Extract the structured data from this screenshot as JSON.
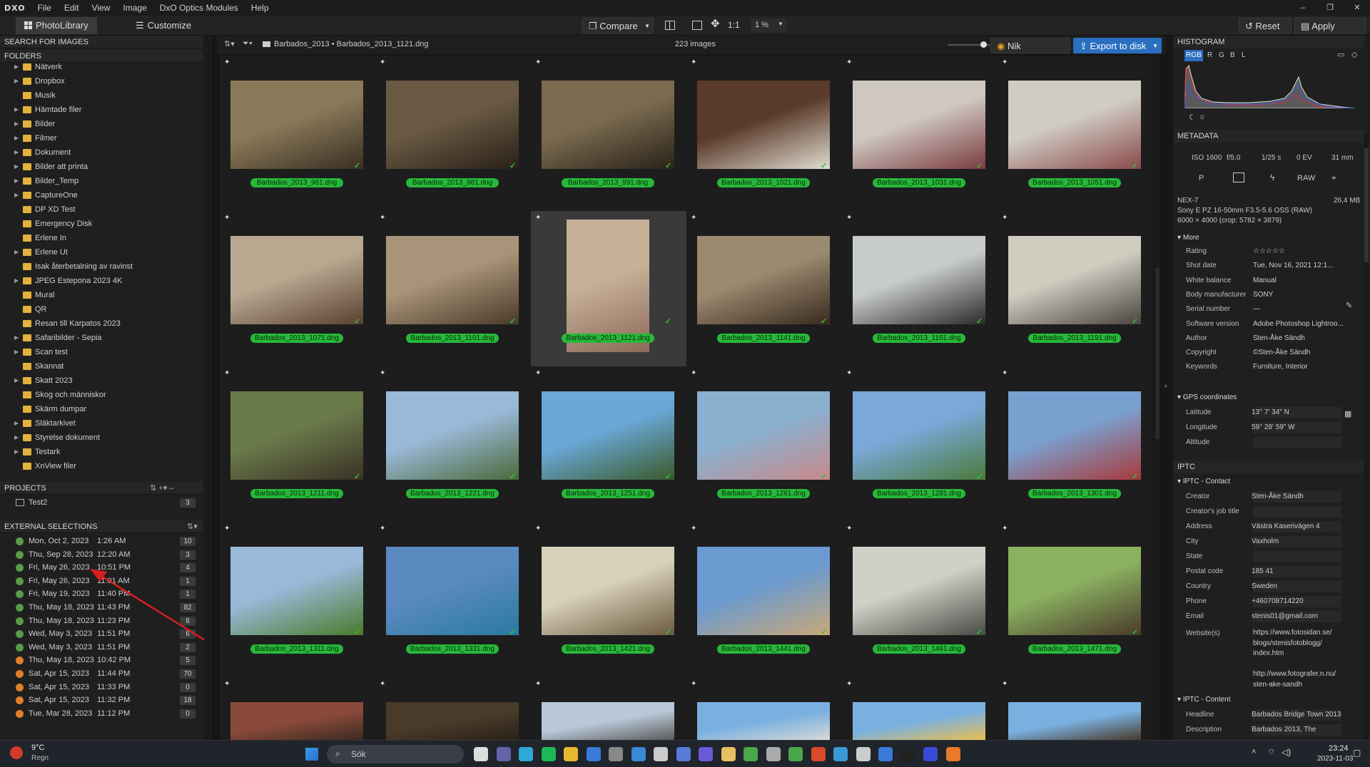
{
  "app": {
    "logo": "DXO",
    "menu": [
      "File",
      "Edit",
      "View",
      "Image",
      "DxO Optics Modules",
      "Help"
    ]
  },
  "window_controls": {
    "min": "–",
    "restore": "❐",
    "close": "✕"
  },
  "toolbar": {
    "tabs": [
      "PhotoLibrary",
      "Customize"
    ],
    "compare": "Compare",
    "one_to_one": "1:1",
    "zoom": "1 %",
    "reset": "Reset",
    "apply_preset": "Apply preset"
  },
  "left": {
    "search_header": "SEARCH FOR IMAGES",
    "folders_header": "FOLDERS",
    "folders": [
      {
        "label": "Nätverk",
        "arrow": true
      },
      {
        "label": "Dropbox",
        "arrow": true
      },
      {
        "label": "Musik",
        "arrow": false
      },
      {
        "label": "Hämtade filer",
        "arrow": true
      },
      {
        "label": "Bilder",
        "arrow": true
      },
      {
        "label": "Filmer",
        "arrow": true
      },
      {
        "label": "Dokument",
        "arrow": true
      },
      {
        "label": "Bilder att printa",
        "arrow": true
      },
      {
        "label": "Bilder_Temp",
        "arrow": true
      },
      {
        "label": "CaptureOne",
        "arrow": true
      },
      {
        "label": "DP XD Test",
        "arrow": false
      },
      {
        "label": "Emergency Disk",
        "arrow": false
      },
      {
        "label": "Erlene In",
        "arrow": false
      },
      {
        "label": "Erlene Ut",
        "arrow": true
      },
      {
        "label": "Isak återbetalning av ravinst",
        "arrow": false
      },
      {
        "label": "JPEG Estepona 2023 4K",
        "arrow": true
      },
      {
        "label": "Mural",
        "arrow": false
      },
      {
        "label": "QR",
        "arrow": false
      },
      {
        "label": "Resan till Karpatos 2023",
        "arrow": false
      },
      {
        "label": "Safaribilder - Sepia",
        "arrow": true
      },
      {
        "label": "Scan test",
        "arrow": true
      },
      {
        "label": "Skannat",
        "arrow": false
      },
      {
        "label": "Skatt 2023",
        "arrow": true
      },
      {
        "label": "Skog och människor",
        "arrow": false
      },
      {
        "label": "Skärm dumpar",
        "arrow": false
      },
      {
        "label": "Släktarkivet",
        "arrow": true
      },
      {
        "label": "Styrelse dokument",
        "arrow": true
      },
      {
        "label": "Testark",
        "arrow": true
      },
      {
        "label": "XnView filer",
        "arrow": false
      }
    ],
    "projects_header": "PROJECTS",
    "projects": [
      {
        "label": "Test2",
        "count": "3"
      }
    ],
    "external_header": "EXTERNAL SELECTIONS",
    "selections": [
      {
        "label": "Mon, Oct 2, 2023",
        "time": "1:26 AM",
        "count": "10",
        "color": "#5a9a4a"
      },
      {
        "label": "Thu, Sep 28, 2023",
        "time": "12:20 AM",
        "count": "3",
        "color": "#5a9a4a"
      },
      {
        "label": "Fri, May 26, 2023",
        "time": "10:51 PM",
        "count": "4",
        "color": "#5a9a4a"
      },
      {
        "label": "Fri, May 26, 2023",
        "time": "11:01 AM",
        "count": "1",
        "color": "#5a9a4a"
      },
      {
        "label": "Fri, May 19, 2023",
        "time": "11:40 PM",
        "count": "1",
        "color": "#5a9a4a"
      },
      {
        "label": "Thu, May 18, 2023",
        "time": "11:43 PM",
        "count": "82",
        "color": "#5a9a4a"
      },
      {
        "label": "Thu, May 18, 2023",
        "time": "11:23 PM",
        "count": "8",
        "color": "#5a9a4a"
      },
      {
        "label": "Wed, May 3, 2023",
        "time": "11:51 PM",
        "count": "6",
        "color": "#5a9a4a"
      },
      {
        "label": "Wed, May 3, 2023",
        "time": "11:51 PM",
        "count": "2",
        "color": "#5a9a4a"
      },
      {
        "label": "Thu, May 18, 2023",
        "time": "10:42 PM",
        "count": "5",
        "color": "#e0802a"
      },
      {
        "label": "Sat, Apr 15, 2023",
        "time": "11:44 PM",
        "count": "70",
        "color": "#e0802a"
      },
      {
        "label": "Sat, Apr 15, 2023",
        "time": "11:33 PM",
        "count": "0",
        "color": "#e0802a"
      },
      {
        "label": "Sat, Apr 15, 2023",
        "time": "11:32 PM",
        "count": "18",
        "color": "#e0802a"
      },
      {
        "label": "Tue, Mar 28, 2023",
        "time": "11:12 PM",
        "count": "0",
        "color": "#e0802a"
      }
    ]
  },
  "browser": {
    "breadcrumb": [
      "Barbados_2013",
      "Barbados_2013_1121.dng"
    ],
    "image_count": "223 images",
    "nik": "Nik Collection",
    "export": "Export to disk",
    "thumbs": [
      {
        "name": "Barbados_2013_961.dng",
        "c1": "#8a7a5a",
        "c2": "#3a2e22"
      },
      {
        "name": "Barbados_2013_981.dng",
        "c1": "#6a5a44",
        "c2": "#2a2018"
      },
      {
        "name": "Barbados_2013_991.dng",
        "c1": "#7a6a50",
        "c2": "#2a2218"
      },
      {
        "name": "Barbados_2013_1021.dng",
        "c1": "#5a3a2a",
        "c2": "#e0dcd0"
      },
      {
        "name": "Barbados_2013_1031.dng",
        "c1": "#cfc8c0",
        "c2": "#7a3a40"
      },
      {
        "name": "Barbados_2013_1051.dng",
        "c1": "#d0ccc4",
        "c2": "#8a4a4a"
      },
      {
        "name": "Barbados_2013_1071.dng",
        "c1": "#b8a890",
        "c2": "#5a4030"
      },
      {
        "name": "Barbados_2013_1101.dng",
        "c1": "#a89478",
        "c2": "#4a3a2a"
      },
      {
        "name": "Barbados_2013_1121.dng",
        "c1": "#c8b098",
        "c2": "#8a6a58"
      },
      {
        "name": "Barbados_2013_1141.dng",
        "c1": "#9a8a70",
        "c2": "#3a2a1e"
      },
      {
        "name": "Barbados_2013_1151.dng",
        "c1": "#c8ccc8",
        "c2": "#2a2a2a"
      },
      {
        "name": "Barbados_2013_1191.dng",
        "c1": "#d0ccc0",
        "c2": "#4a4440"
      },
      {
        "name": "Barbados_2013_1211.dng",
        "c1": "#6a7a4a",
        "c2": "#3a3226"
      },
      {
        "name": "Barbados_2013_1221.dng",
        "c1": "#9ab8d8",
        "c2": "#4a6a3a"
      },
      {
        "name": "Barbados_2013_1251.dng",
        "c1": "#6aa8d8",
        "c2": "#3a5a2a"
      },
      {
        "name": "Barbados_2013_1261.dng",
        "c1": "#8ab0d0",
        "c2": "#c88a8a"
      },
      {
        "name": "Barbados_2013_1281.dng",
        "c1": "#7aa8d8",
        "c2": "#4a7a3a"
      },
      {
        "name": "Barbados_2013_1301.dng",
        "c1": "#7aa0d0",
        "c2": "#a83a3a"
      },
      {
        "name": "Barbados_2013_1311.dng",
        "c1": "#9ab8d8",
        "c2": "#4a7a2a"
      },
      {
        "name": "Barbados_2013_1331.dng",
        "c1": "#5a8ac0",
        "c2": "#2a7aa0"
      },
      {
        "name": "Barbados_2013_1421.dng",
        "c1": "#d8d0b8",
        "c2": "#6a5a40"
      },
      {
        "name": "Barbados_2013_1441.dng",
        "c1": "#6a9ad0",
        "c2": "#c8a878"
      },
      {
        "name": "Barbados_2013_1461.dng",
        "c1": "#d0d0c8",
        "c2": "#4a4a44"
      },
      {
        "name": "Barbados_2013_1471.dng",
        "c1": "#8ab060",
        "c2": "#4a3a2a"
      }
    ],
    "partial_row": [
      {
        "c1": "#8a4a3a",
        "c2": "#3a2a20"
      },
      {
        "c1": "#4a3a2a",
        "c2": "#2a2218"
      },
      {
        "c1": "#b8c8d8",
        "c2": "#5a5a5a"
      },
      {
        "c1": "#7ab0e0",
        "c2": "#d8d8d8"
      },
      {
        "c1": "#7ab0e0",
        "c2": "#e8c050"
      },
      {
        "c1": "#7ab0e0",
        "c2": "#4a3a2a"
      }
    ]
  },
  "right": {
    "histogram_header": "HISTOGRAM",
    "channels": [
      "RGB",
      "R",
      "G",
      "B",
      "L"
    ],
    "metadata_header": "METADATA",
    "exif": [
      "ISO 1600",
      "f/5.0",
      "1/25 s",
      "0 EV",
      "31 mm"
    ],
    "modes": [
      "P",
      "RAW"
    ],
    "camera": "NEX-7",
    "filesize": "26,4 MB",
    "lens": "Sony E PZ 16-50mm F3.5-5.6 OSS (RAW)",
    "dimensions": "6000 × 4000  (crop: 5782 × 3879)",
    "more_header": "More",
    "more": [
      {
        "k": "Rating",
        "v": "☆☆☆☆☆"
      },
      {
        "k": "Shot date",
        "v": "Tue, Nov 16, 2021 12:1..."
      },
      {
        "k": "White balance",
        "v": "Manual"
      },
      {
        "k": "Body manufacturer",
        "v": "SONY"
      },
      {
        "k": "Serial number",
        "v": "—"
      },
      {
        "k": "Software version",
        "v": "Adobe Photoshop Lightroo..."
      },
      {
        "k": "Author",
        "v": "Sten-Åke Sändh"
      },
      {
        "k": "Copyright",
        "v": "©Sten-Åke Sändh"
      },
      {
        "k": "Keywords",
        "v": "Furniture, Interior"
      }
    ],
    "gps_header": "GPS coordinates",
    "gps": [
      {
        "k": "Latitude",
        "v": "13° 7' 34\" N"
      },
      {
        "k": "Longitude",
        "v": "59° 28' 59\" W"
      },
      {
        "k": "Altitude",
        "v": ""
      }
    ],
    "iptc_header": "IPTC",
    "iptc_contact_header": "IPTC - Contact",
    "iptc_contact": [
      {
        "k": "Creator",
        "v": "Sten-Åke Sändh"
      },
      {
        "k": "Creator's job title",
        "v": ""
      },
      {
        "k": "Address",
        "v": "Västra Kaserivägen 4"
      },
      {
        "k": "City",
        "v": "Vaxholm"
      },
      {
        "k": "State",
        "v": ""
      },
      {
        "k": "Postal code",
        "v": "185 41"
      },
      {
        "k": "Country",
        "v": "Sweden"
      },
      {
        "k": "Phone",
        "v": "+460708714220"
      },
      {
        "k": "Email",
        "v": "stenis01@gmail.com"
      }
    ],
    "website_label": "Website(s)",
    "websites": [
      "https://www.fotosidan.se/",
      "blogs/stenisfotoblogg/",
      "index.htm",
      "",
      "http://www.fotografer.n.nu/",
      "sten-ake-sandh"
    ],
    "iptc_content_header": "IPTC - Content",
    "iptc_content": [
      {
        "k": "Headline",
        "v": "Barbados Bridge Town  2013"
      },
      {
        "k": "Description",
        "v": "Barbados 2013, The"
      }
    ]
  },
  "taskbar": {
    "weather_temp": "9°C",
    "weather_desc": "Regn",
    "search": "Sök",
    "time": "23:24",
    "date": "2023-11-03"
  }
}
